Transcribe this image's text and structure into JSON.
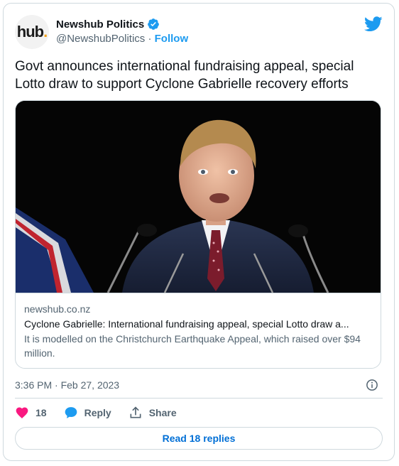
{
  "author": {
    "avatar_text": "hub",
    "avatar_dot": ".",
    "display_name": "Newshub Politics",
    "handle": "@NewshubPolitics",
    "separator": " · ",
    "follow_label": "Follow"
  },
  "tweet": {
    "text": "Govt announces international fundraising appeal, special Lotto draw to support Cyclone Gabrielle recovery efforts",
    "timestamp": "3:36 PM · Feb 27, 2023"
  },
  "card": {
    "domain": "newshub.co.nz",
    "title": "Cyclone Gabrielle: International fundraising appeal, special Lotto draw a...",
    "description": "It is modelled on the Christchurch Earthquake Appeal, which raised over $94 million."
  },
  "actions": {
    "like_count": "18",
    "reply_label": "Reply",
    "share_label": "Share"
  },
  "replies_button_label": "Read 18 replies",
  "icons": {
    "verified": "verified-badge-icon",
    "twitter": "twitter-bird-icon",
    "info": "info-icon",
    "like": "heart-icon",
    "reply": "speech-bubble-icon",
    "share": "share-icon"
  },
  "colors": {
    "brand_blue": "#1d9bf0",
    "like_pink": "#f91880",
    "text_secondary": "#536471",
    "border": "#cfd9de"
  }
}
